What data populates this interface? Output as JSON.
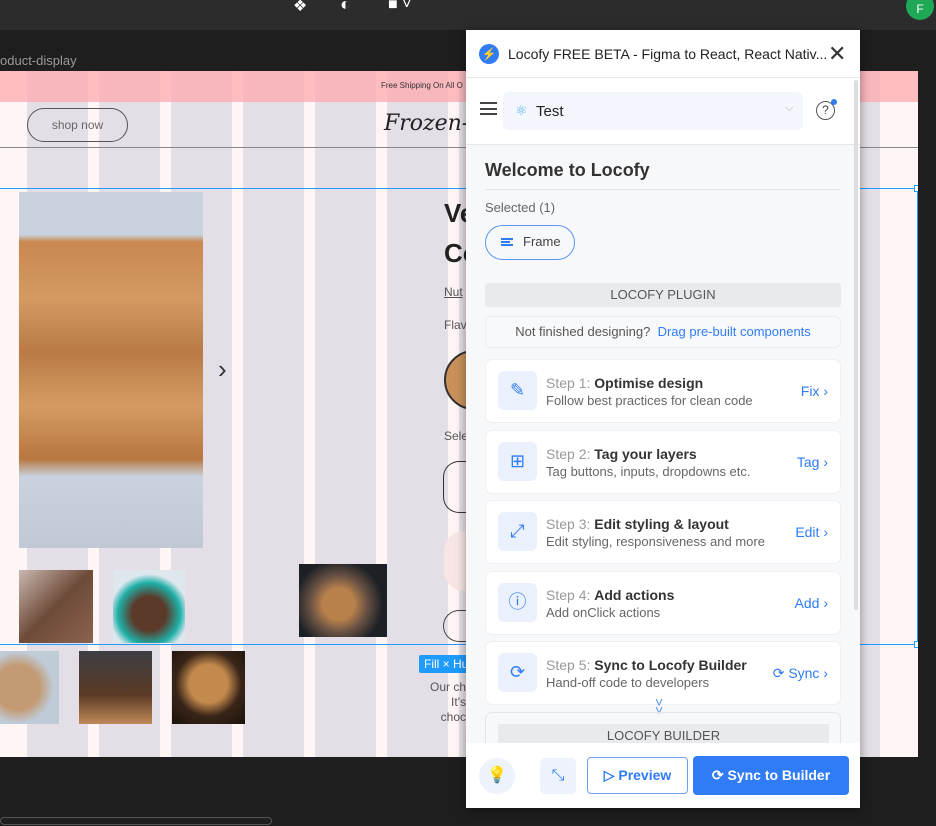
{
  "figma": {
    "frame_label": "oduct-display",
    "avatar_initial": "F",
    "toolbar_icons": [
      "component-icon",
      "contrast-icon",
      "fill-icon"
    ]
  },
  "site": {
    "shipping": "Free Shipping On All O",
    "shop_now": "shop now",
    "logo": "Frozen-C",
    "title_1": "Ve",
    "title_2": "Co",
    "nutrition": "Nut",
    "flavor": "Flav",
    "select": "Sele",
    "desc_1": "Our ch",
    "desc_2": "It's",
    "desc_3": "choc",
    "fill_badge": "Fill × Hu"
  },
  "plugin": {
    "title": "Locofy FREE BETA - Figma to React, React Nativ...",
    "project": "Test",
    "welcome": "Welcome to Locofy",
    "selected": "Selected (1)",
    "frame": "Frame",
    "plugin_header": "LOCOFY PLUGIN",
    "not_finished": "Not finished designing?",
    "drag_link": "Drag pre-built components",
    "steps": [
      {
        "num": "Step 1:",
        "title": "Optimise design",
        "desc": "Follow best practices for clean code",
        "action": "Fix",
        "icon": "optimise-icon"
      },
      {
        "num": "Step 2:",
        "title": "Tag your layers",
        "desc": "Tag buttons, inputs, dropdowns etc.",
        "action": "Tag",
        "icon": "tag-icon"
      },
      {
        "num": "Step 3:",
        "title": "Edit styling & layout",
        "desc": "Edit styling, responsiveness and more",
        "action": "Edit",
        "icon": "edit-layout-icon"
      },
      {
        "num": "Step 4:",
        "title": "Add actions",
        "desc": "Add onClick actions",
        "action": "Add",
        "icon": "actions-icon"
      },
      {
        "num": "Step 5:",
        "title": "Sync to Locofy Builder",
        "desc": "Hand-off code to developers",
        "action": "Sync",
        "icon": "sync-icon"
      }
    ],
    "builder_header": "LOCOFY BUILDER",
    "preview": "Preview",
    "sync_builder": "Sync to Builder",
    "accent": "#2f7cf6"
  }
}
